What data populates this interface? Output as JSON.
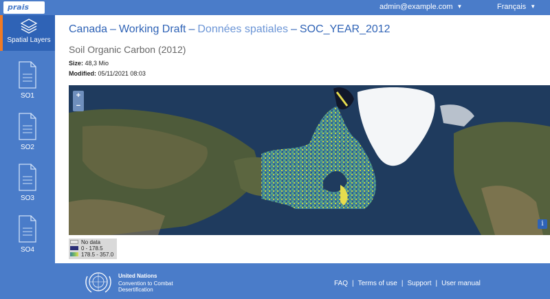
{
  "header": {
    "logo": "prais",
    "user_menu": "admin@example.com",
    "language_menu": "Français"
  },
  "sidebar": {
    "items": [
      {
        "label": "Spatial Layers",
        "icon": "layers-icon",
        "active": true
      },
      {
        "label": "SO1",
        "icon": "document-icon"
      },
      {
        "label": "SO2",
        "icon": "document-icon"
      },
      {
        "label": "SO3",
        "icon": "document-icon"
      },
      {
        "label": "SO4",
        "icon": "document-icon"
      }
    ]
  },
  "breadcrumb": {
    "part1": "Canada",
    "part2": "Working Draft",
    "part3": "Données spatiales",
    "part4": "SOC_YEAR_2012",
    "separator": "–"
  },
  "page": {
    "subtitle": "Soil Organic Carbon (2012)",
    "size_label": "Size:",
    "size_value": "48,3 Mio",
    "modified_label": "Modified:",
    "modified_value": "05/11/2021 08:03"
  },
  "map": {
    "zoom_in": "+",
    "zoom_out": "−",
    "info": "i",
    "legend": [
      {
        "label": "No data",
        "color": "#e6e6e6"
      },
      {
        "label": "0 - 178.5",
        "color": "#2b2f77"
      },
      {
        "label": "178.5 - 357.0",
        "color": "#6fb86a"
      }
    ]
  },
  "footer": {
    "org_name": "United Nations",
    "org_line2": "Convention to Combat",
    "org_line3": "Desertification",
    "links": [
      "FAQ",
      "Terms of use",
      "Support",
      "User manual"
    ],
    "link_separator": "|"
  },
  "colors": {
    "primary": "#4a7cc9",
    "primary_dark": "#2f63b6",
    "accent": "#f07a23"
  }
}
